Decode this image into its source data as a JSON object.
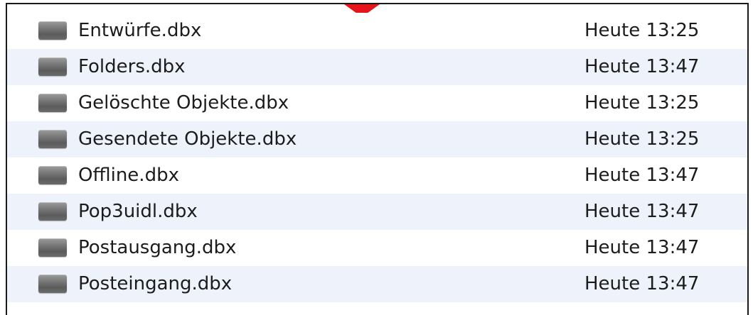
{
  "marker": {
    "color": "#e8141b"
  },
  "files": [
    {
      "name": "Entwürfe.dbx",
      "date": "Heute 13:25",
      "icon": "file-icon"
    },
    {
      "name": "Folders.dbx",
      "date": "Heute 13:47",
      "icon": "file-icon"
    },
    {
      "name": "Gelöschte Objekte.dbx",
      "date": "Heute 13:25",
      "icon": "file-icon"
    },
    {
      "name": "Gesendete Objekte.dbx",
      "date": "Heute 13:25",
      "icon": "file-icon"
    },
    {
      "name": "Offline.dbx",
      "date": "Heute 13:47",
      "icon": "file-icon"
    },
    {
      "name": "Pop3uidl.dbx",
      "date": "Heute 13:47",
      "icon": "file-icon"
    },
    {
      "name": "Postausgang.dbx",
      "date": "Heute 13:47",
      "icon": "file-icon"
    },
    {
      "name": "Posteingang.dbx",
      "date": "Heute 13:47",
      "icon": "file-icon"
    }
  ]
}
